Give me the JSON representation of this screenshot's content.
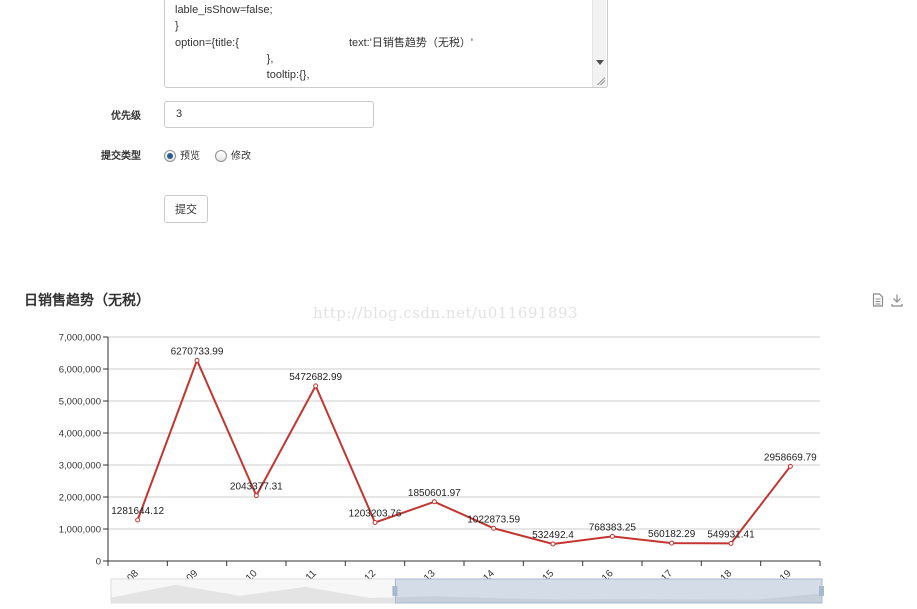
{
  "form": {
    "code_lines": [
      "lable_isShow=false;",
      "}",
      "option={title:{                                    text:'日销售趋势（无税）'",
      "                              },",
      "                              tooltip:{},"
    ],
    "priority_label": "优先级",
    "priority_value": "3",
    "submit_type_label": "提交类型",
    "radio_preview": "预览",
    "radio_modify": "修改",
    "radio_selected": "预览",
    "submit_button": "提交"
  },
  "watermark": "http://blog.csdn.net/u011691893",
  "toolbar": {
    "icons": [
      "data-view-icon",
      "download-icon"
    ]
  },
  "chart_data": {
    "type": "line",
    "title": "日销售趋势（无税）",
    "categories": [
      "09-08",
      "09-09",
      "09-10",
      "09-11",
      "09-12",
      "09-13",
      "09-14",
      "09-15",
      "09-16",
      "09-17",
      "09-18",
      "09-19"
    ],
    "values": [
      1281644.12,
      6270733.99,
      2043377.31,
      5472682.99,
      1203203.76,
      1850601.97,
      1022873.59,
      532492.4,
      768383.25,
      560182.29,
      549931.41,
      2958669.79
    ],
    "data_labels": [
      "1281644.12",
      "6270733.99",
      "2043377.31",
      "5472682.99",
      "1203203.76",
      "1850601.97",
      "1022873.59",
      "532492.4",
      "768383.25",
      "560182.29",
      "549931.41",
      "2958669.79"
    ],
    "y_ticks": [
      "0",
      "1,000,000",
      "2,000,000",
      "3,000,000",
      "4,000,000",
      "5,000,000",
      "6,000,000",
      "7,000,000"
    ],
    "ylim": [
      0,
      7000000
    ],
    "grid": true,
    "line_color": "#c23531",
    "data_zoom": {
      "start": 0.4,
      "end": 1.0
    }
  }
}
